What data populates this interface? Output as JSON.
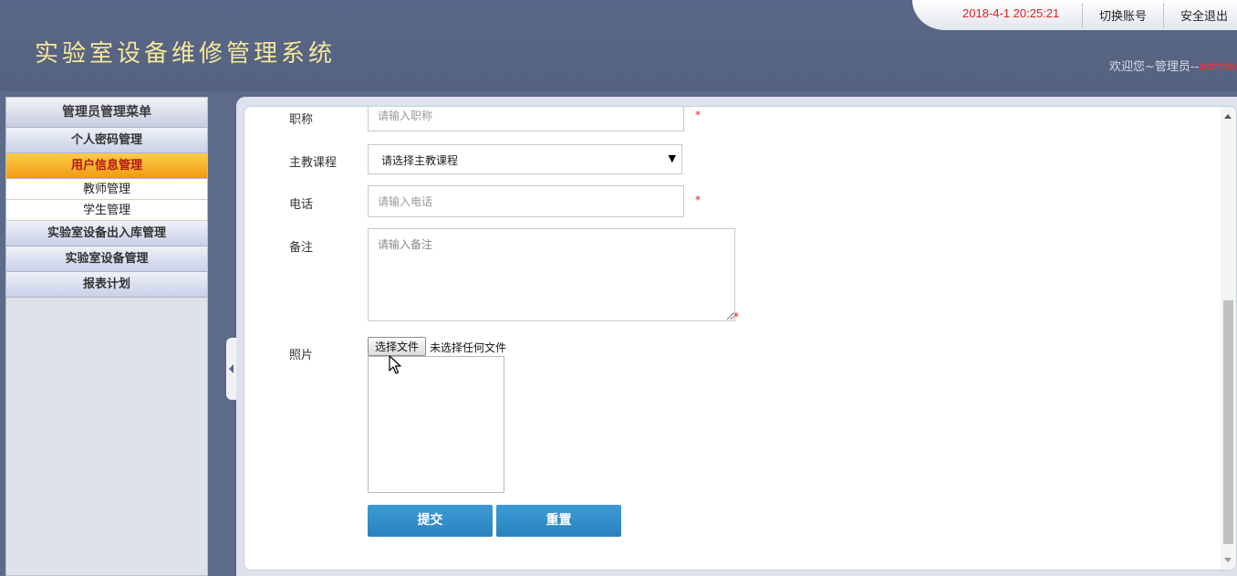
{
  "header": {
    "app_title": "实验室设备维修管理系统",
    "datetime": "2018-4-1 20:25:21",
    "switch_account": "切换账号",
    "logout": "安全退出",
    "welcome_prefix": "欢迎您~管理员--",
    "username": "admin"
  },
  "sidebar": {
    "title": "管理员管理菜单",
    "items": [
      {
        "label": "个人密码管理"
      },
      {
        "label": "用户信息管理",
        "active": true
      },
      {
        "label": "实验室设备出入库管理"
      },
      {
        "label": "实验室设备管理"
      },
      {
        "label": "报表计划"
      }
    ],
    "sub_items": [
      {
        "label": "教师管理"
      },
      {
        "label": "学生管理"
      }
    ]
  },
  "form": {
    "title_label": "职称",
    "title_placeholder": "请输入职称",
    "course_label": "主教课程",
    "course_selected": "请选择主教课程",
    "phone_label": "电话",
    "phone_placeholder": "请输入电话",
    "remark_label": "备注",
    "remark_placeholder": "请输入备注",
    "photo_label": "照片",
    "file_button": "选择文件",
    "file_status": "未选择任何文件",
    "required_mark": "*",
    "submit": "提交",
    "reset": "重置"
  },
  "colors": {
    "header_bg": "#5a6788",
    "title_text": "#f4e79a",
    "datetime": "#e02020",
    "active_menu": "#f19b10",
    "primary_button": "#2a82bd"
  }
}
